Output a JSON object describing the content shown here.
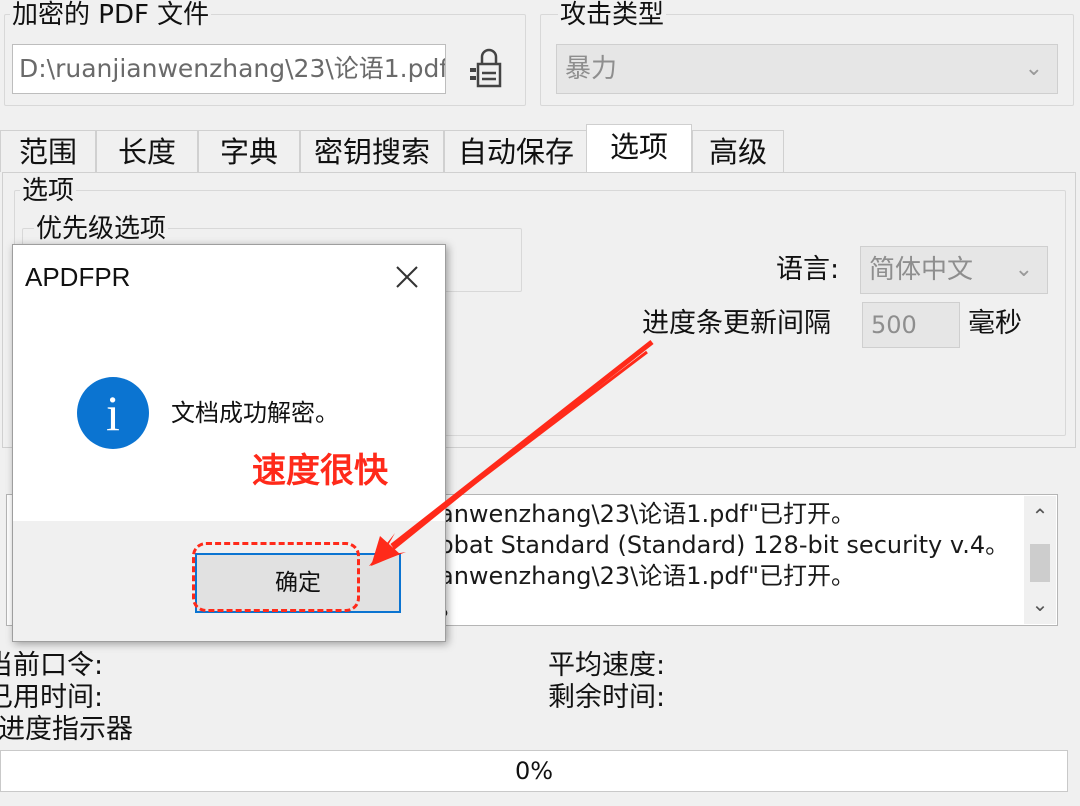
{
  "file_group": {
    "title": "加密的 PDF 文件",
    "path": "D:\\ruanjianwenzhang\\23\\论语1.pdf"
  },
  "attack_group": {
    "title": "攻击类型",
    "selected": "暴力"
  },
  "tabs": [
    "范围",
    "长度",
    "字典",
    "密钥搜索",
    "自动保存",
    "选项",
    "高级"
  ],
  "options_panel": {
    "title": "选项",
    "priority_title": "优先级选项",
    "language_label": "语言:",
    "language_value": "简体中文",
    "progress_label": "进度条更新间隔",
    "progress_value": "500",
    "progress_unit": "毫秒"
  },
  "log_lines": [
    "anwenzhang\\23\\论语1.pdf\"已打开。",
    "obat Standard (Standard) 128-bit security v.4。",
    "anwenzhang\\23\\论语1.pdf\"已打开。",
    "。"
  ],
  "status": {
    "current_password_label": "当前口令:",
    "elapsed_label": "已用时间:",
    "progress_label": "进度指示器",
    "avg_speed_label": "平均速度:",
    "remaining_label": "剩余时间:",
    "progress_text": "0%",
    "progress_fraction": 0
  },
  "dialog": {
    "title": "APDFPR",
    "message": "文档成功解密。",
    "ok_label": "确定"
  },
  "annotation": {
    "text": "速度很快",
    "color": "#ff2a1a"
  },
  "colors": {
    "accent_blue": "#0b74d1",
    "annotation_red": "#ff2a1a"
  }
}
